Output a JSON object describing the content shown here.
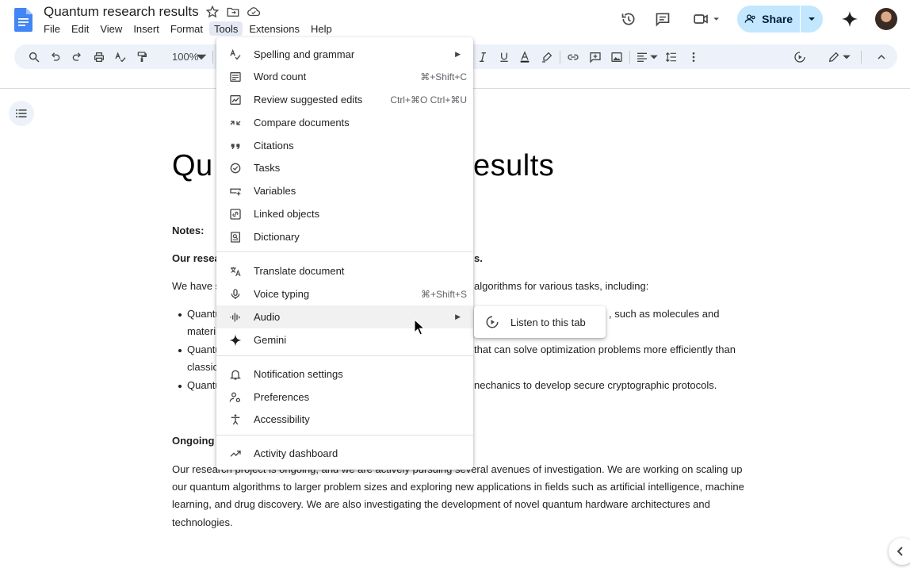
{
  "doc": {
    "title": "Quantum research results",
    "menus": [
      "File",
      "Edit",
      "View",
      "Insert",
      "Format",
      "Tools",
      "Extensions",
      "Help"
    ],
    "active_menu": "Tools"
  },
  "header": {
    "share_label": "Share"
  },
  "toolbar": {
    "zoom": "100%"
  },
  "document": {
    "heading_left": "Qu",
    "heading_right": "esults",
    "notes_label": "Notes:",
    "our_research_left": "Our resea",
    "our_research_right": "s.",
    "we_have_left": "We have s",
    "we_have_right": "algorithms for various tasks, including:",
    "bullets": [
      {
        "line1_left": "Quantu",
        "line1_right": ", such as molecules and",
        "line2_left": "materi"
      },
      {
        "line1_left": "Quantu",
        "line1_right": "that can solve optimization problems more efficiently than",
        "line2_left": "classic"
      },
      {
        "line1_left": "Quantu",
        "line1_right": "nechanics to develop secure cryptographic protocols."
      }
    ],
    "ongoing_label": "Ongoing",
    "paragraph_lines": [
      "Our research project is ongoing, and we are actively pursuing several avenues of investigation. We are working on scaling up",
      "our quantum algorithms to larger problem sizes and exploring new applications in fields such as artificial intelligence, machine",
      "learning, and drug discovery. We are also investigating the development of novel quantum hardware architectures and",
      "technologies."
    ]
  },
  "tools_menu": {
    "items": [
      {
        "label": "Spelling and grammar",
        "icon": "spellcheck-icon",
        "submenu": true
      },
      {
        "label": "Word count",
        "icon": "word-count-icon",
        "shortcut": "⌘+Shift+C"
      },
      {
        "label": "Review suggested edits",
        "icon": "review-edits-icon",
        "shortcut": "Ctrl+⌘O Ctrl+⌘U"
      },
      {
        "label": "Compare documents",
        "icon": "compare-icon"
      },
      {
        "label": "Citations",
        "icon": "quote-icon"
      },
      {
        "label": "Tasks",
        "icon": "check-circle-icon"
      },
      {
        "label": "Variables",
        "icon": "variables-icon"
      },
      {
        "label": "Linked objects",
        "icon": "linked-objects-icon"
      },
      {
        "label": "Dictionary",
        "icon": "dictionary-icon"
      },
      {
        "label": "Translate document",
        "icon": "translate-icon"
      },
      {
        "label": "Voice typing",
        "icon": "mic-icon",
        "shortcut": "⌘+Shift+S"
      },
      {
        "label": "Audio",
        "icon": "audio-icon",
        "submenu": true,
        "highlighted": true
      },
      {
        "label": "Gemini",
        "icon": "gemini-icon"
      },
      {
        "label": "Notification settings",
        "icon": "bell-icon"
      },
      {
        "label": "Preferences",
        "icon": "preferences-icon"
      },
      {
        "label": "Accessibility",
        "icon": "accessibility-icon"
      },
      {
        "label": "Activity dashboard",
        "icon": "trending-icon"
      }
    ]
  },
  "audio_submenu": {
    "items": [
      {
        "label": "Listen to this tab",
        "icon": "listen-icon"
      }
    ]
  },
  "colors": {
    "accent": "#c2e7ff",
    "toolbar_bg": "#edf2fa",
    "doc_blue": "#4285f4"
  }
}
